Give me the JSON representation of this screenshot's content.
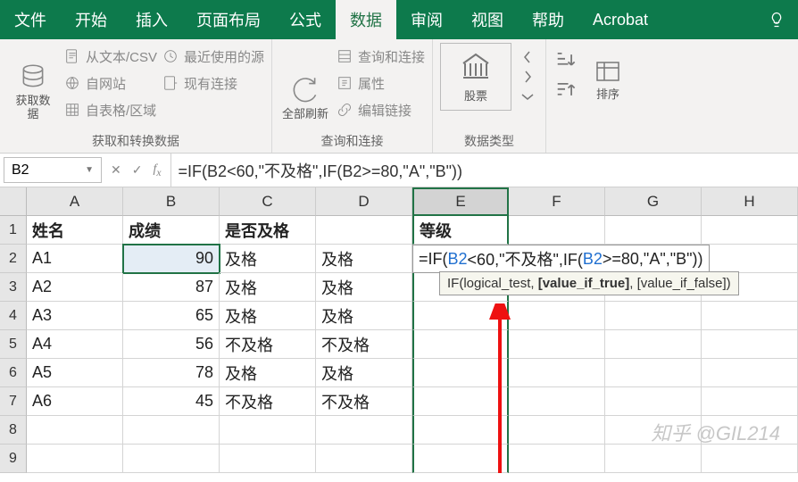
{
  "tabs": {
    "file": "文件",
    "home": "开始",
    "insert": "插入",
    "layout": "页面布局",
    "formulas": "公式",
    "data": "数据",
    "review": "审阅",
    "view": "视图",
    "help": "帮助",
    "acrobat": "Acrobat"
  },
  "ribbon": {
    "getdata_big": "获取数\n据",
    "from_csv": "从文本/CSV",
    "from_web": "自网站",
    "from_table": "自表格/区域",
    "recent": "最近使用的源",
    "existing": "现有连接",
    "group1_label": "获取和转换数据",
    "refresh_big": "全部刷新",
    "queries": "查询和连接",
    "props": "属性",
    "editlinks": "编辑链接",
    "group2_label": "查询和连接",
    "stocks": "股票",
    "group3_label": "数据类型",
    "sort": "排序"
  },
  "formula_bar": {
    "namebox": "B2",
    "formula": "=IF(B2<60,\"不及格\",IF(B2>=80,\"A\",\"B\"))"
  },
  "columns": [
    "A",
    "B",
    "C",
    "D",
    "E",
    "F",
    "G",
    "H"
  ],
  "headers": {
    "A": "姓名",
    "B": "成绩",
    "C": "是否及格",
    "D": "",
    "E": "等级"
  },
  "rows": [
    {
      "n": "1",
      "A": "姓名",
      "B": "成绩",
      "C": "是否及格",
      "D": "",
      "E": "等级",
      "bold": true
    },
    {
      "n": "2",
      "A": "A1",
      "B": "90",
      "C": "及格",
      "D": "及格",
      "E": ""
    },
    {
      "n": "3",
      "A": "A2",
      "B": "87",
      "C": "及格",
      "D": "及格",
      "E": ""
    },
    {
      "n": "4",
      "A": "A3",
      "B": "65",
      "C": "及格",
      "D": "及格",
      "E": ""
    },
    {
      "n": "5",
      "A": "A4",
      "B": "56",
      "C": "不及格",
      "D": "不及格",
      "E": ""
    },
    {
      "n": "6",
      "A": "A5",
      "B": "78",
      "C": "及格",
      "D": "及格",
      "E": ""
    },
    {
      "n": "7",
      "A": "A6",
      "B": "45",
      "C": "不及格",
      "D": "不及格",
      "E": ""
    },
    {
      "n": "8",
      "A": "",
      "B": "",
      "C": "",
      "D": "",
      "E": ""
    },
    {
      "n": "9",
      "A": "",
      "B": "",
      "C": "",
      "D": "",
      "E": ""
    }
  ],
  "typed_formula": {
    "prefix": "=IF(",
    "ref1": "B2",
    "mid1": "<60,\"不及格\",IF(",
    "ref2": "B2",
    "mid2": ">=80,\"A\",\"B\"))"
  },
  "tooltip": {
    "fn": "IF(logical_test, ",
    "arg_b": "[value_if_true]",
    "rest": ", [value_if_false])"
  },
  "watermark": "知乎 @GIL214"
}
